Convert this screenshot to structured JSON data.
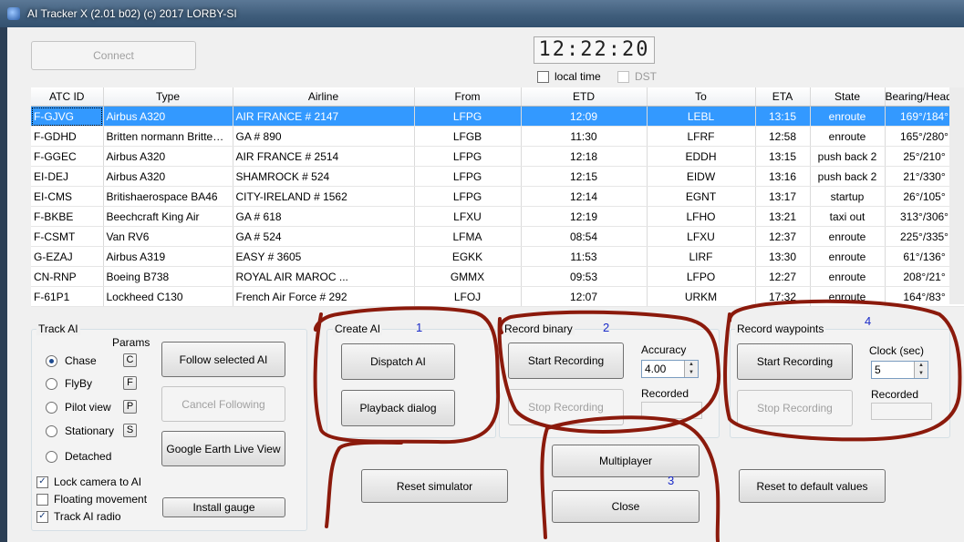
{
  "window": {
    "title": "AI Tracker X (2.01 b02) (c) 2017 LORBY-SI"
  },
  "top": {
    "connect_label": "Connect",
    "clock": "12:22:20",
    "local_time_label": "local time",
    "dst_label": "DST"
  },
  "table": {
    "columns": [
      "ATC ID",
      "Type",
      "Airline",
      "From",
      "ETD",
      "To",
      "ETA",
      "State",
      "Bearing/Heading"
    ],
    "rows": [
      [
        "F-GJVG",
        "Airbus  A320",
        "AIR FRANCE # 2147",
        "LFPG",
        "12:09",
        "LEBL",
        "13:15",
        "enroute",
        "169°/184°"
      ],
      [
        "F-GDHD",
        "Britten normann Britten no...",
        "GA # 890",
        "LFGB",
        "11:30",
        "LFRF",
        "12:58",
        "enroute",
        "165°/280°"
      ],
      [
        "F-GGEC",
        "Airbus  A320",
        "AIR FRANCE # 2514",
        "LFPG",
        "12:18",
        "EDDH",
        "13:15",
        "push back 2",
        "25°/210°"
      ],
      [
        "EI-DEJ",
        "Airbus  A320",
        "SHAMROCK # 524",
        "LFPG",
        "12:15",
        "EIDW",
        "13:16",
        "push back 2",
        "21°/330°"
      ],
      [
        "EI-CMS",
        "Britishaerospace  BA46",
        "CITY-IRELAND # 1562",
        "LFPG",
        "12:14",
        "EGNT",
        "13:17",
        "startup",
        "26°/105°"
      ],
      [
        "F-BKBE",
        "Beechcraft  King Air",
        "GA # 618",
        "LFXU",
        "12:19",
        "LFHO",
        "13:21",
        "taxi out",
        "313°/306°"
      ],
      [
        "F-CSMT",
        "Van  RV6",
        "GA # 524",
        "LFMA",
        "08:54",
        "LFXU",
        "12:37",
        "enroute",
        "225°/335°"
      ],
      [
        "G-EZAJ",
        "Airbus  A319",
        "EASY # 3605",
        "EGKK",
        "11:53",
        "LIRF",
        "13:30",
        "enroute",
        "61°/136°"
      ],
      [
        "CN-RNP",
        "Boeing  B738",
        "ROYAL AIR MAROC ...",
        "GMMX",
        "09:53",
        "LFPO",
        "12:27",
        "enroute",
        "208°/21°"
      ],
      [
        "F-61P1",
        "Lockheed  C130",
        "French Air Force # 292",
        "LFOJ",
        "12:07",
        "URKM",
        "17:32",
        "enroute",
        "164°/83°"
      ]
    ]
  },
  "track_ai": {
    "title": "Track AI",
    "params_label": "Params",
    "modes": [
      {
        "label": "Chase",
        "param": "C"
      },
      {
        "label": "FlyBy",
        "param": "F"
      },
      {
        "label": "Pilot view",
        "param": "P"
      },
      {
        "label": "Stationary",
        "param": "S"
      },
      {
        "label": "Detached",
        "param": ""
      }
    ],
    "follow_label": "Follow selected AI",
    "cancel_label": "Cancel Following",
    "google_label": "Google Earth Live View",
    "lock_camera_label": "Lock camera to AI",
    "floating_label": "Floating movement",
    "track_radio_label": "Track AI radio",
    "install_label": "Install gauge"
  },
  "create_ai": {
    "title": "Create AI",
    "dispatch_label": "Dispatch AI",
    "playback_label": "Playback dialog"
  },
  "record_binary": {
    "title": "Record binary",
    "start_label": "Start Recording",
    "stop_label": "Stop Recording",
    "accuracy_label": "Accuracy",
    "accuracy_value": "4.00",
    "recorded_label": "Recorded"
  },
  "record_waypoints": {
    "title": "Record waypoints",
    "start_label": "Start Recording",
    "stop_label": "Stop Recording",
    "clock_label": "Clock (sec)",
    "clock_value": "5",
    "recorded_label": "Recorded"
  },
  "bottom": {
    "multiplayer_label": "Multiplayer",
    "close_label": "Close",
    "reset_sim_label": "Reset simulator",
    "reset_default_label": "Reset to default values"
  },
  "annotations": {
    "n1": "1",
    "n2": "2",
    "n3": "3",
    "n4": "4",
    "color": "#8b1a0c"
  }
}
